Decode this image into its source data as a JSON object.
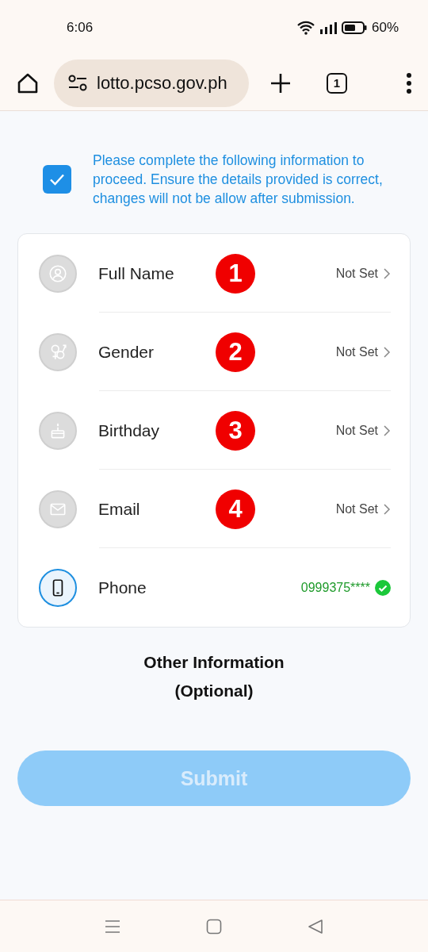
{
  "status_bar": {
    "time": "6:06",
    "battery": "60%"
  },
  "browser": {
    "url": "lotto.pcso.gov.ph",
    "tab_count": "1"
  },
  "notice": {
    "checked": true,
    "text": "Please complete the following information to proceed. Ensure the details provided is correct, changes will not be allow after submission."
  },
  "fields": [
    {
      "kind": "name",
      "label": "Full Name",
      "value": "Not Set",
      "verified": false,
      "marker": "1"
    },
    {
      "kind": "gender",
      "label": "Gender",
      "value": "Not Set",
      "verified": false,
      "marker": "2"
    },
    {
      "kind": "birthday",
      "label": "Birthday",
      "value": "Not Set",
      "verified": false,
      "marker": "3"
    },
    {
      "kind": "email",
      "label": "Email",
      "value": "Not Set",
      "verified": false,
      "marker": "4"
    },
    {
      "kind": "phone",
      "label": "Phone",
      "value": "0999375****",
      "verified": true
    }
  ],
  "other_info": {
    "title": "Other Information",
    "subtitle": "(Optional)"
  },
  "submit": {
    "label": "Submit",
    "disabled": true
  }
}
